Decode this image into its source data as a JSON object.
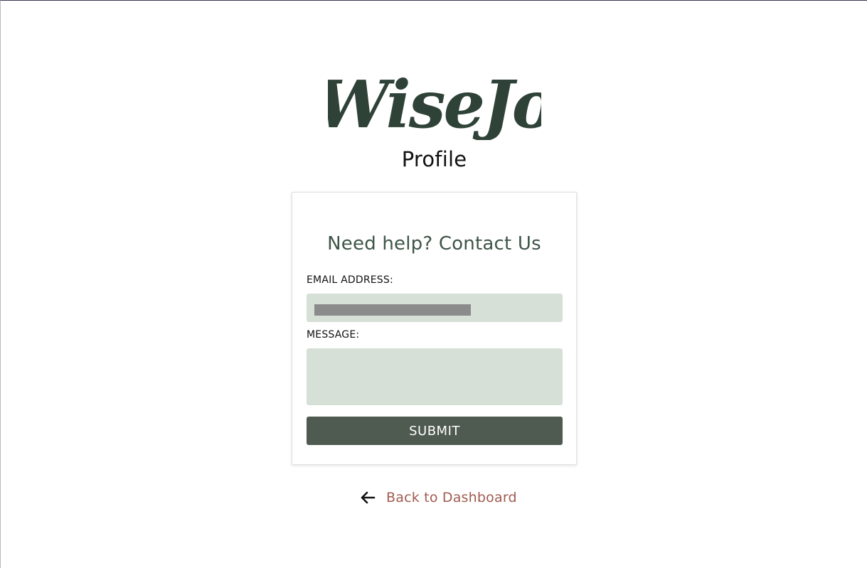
{
  "brand": {
    "logo_text": "WiseJo",
    "logo_color": "#2f4238"
  },
  "page": {
    "title": "Profile"
  },
  "contact_form": {
    "heading": "Need help? Contact Us",
    "email_label": "EMAIL ADDRESS:",
    "email_value": "",
    "message_label": "MESSAGE:",
    "message_value": "",
    "submit_label": "SUBMIT"
  },
  "navigation": {
    "back_label": "Back to Dashboard",
    "back_icon": "arrow-left-icon"
  },
  "colors": {
    "input_bg": "#d6e0d7",
    "button_bg": "#4f5a50",
    "heading": "#3e5547",
    "link": "#a05b4f"
  }
}
